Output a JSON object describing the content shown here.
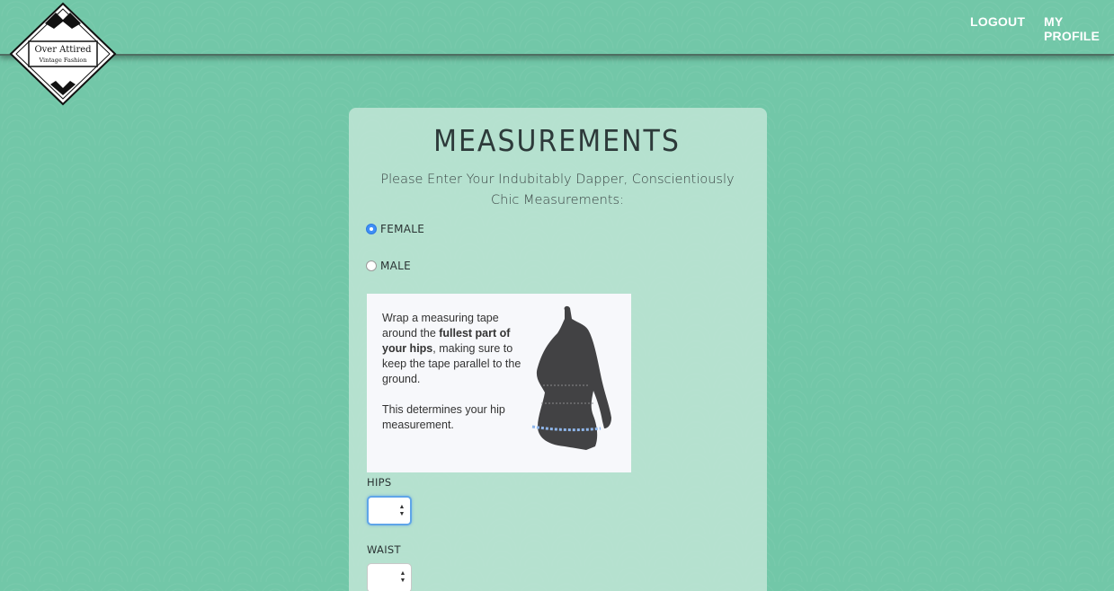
{
  "nav": {
    "logout": "LOGOUT",
    "my_profile": "MY PROFILE"
  },
  "logo": {
    "line1": "Over Attired",
    "line2": "Vintage Fashion"
  },
  "card": {
    "title": "MEASUREMENTS",
    "subtitle": "Please Enter Your Indubitably Dapper, Conscientiously Chic Measurements:"
  },
  "gender": {
    "options": [
      {
        "label": "FEMALE",
        "checked": true
      },
      {
        "label": "MALE",
        "checked": false
      }
    ]
  },
  "instruction": {
    "p1_pre": "Wrap a measuring tape around the ",
    "p1_bold": "fullest part of your hips",
    "p1_post": ", making sure to keep the tape parallel to the ground.",
    "p2": "This determines your hip measurement."
  },
  "fields": {
    "hips": {
      "label": "HIPS",
      "value": ""
    },
    "waist": {
      "label": "WAIST",
      "value": ""
    }
  },
  "colors": {
    "background": "#72c7a8",
    "card": "#c8e8da",
    "radio_selected": "#3f8ff7",
    "tape_line": "#8fb6ea"
  }
}
